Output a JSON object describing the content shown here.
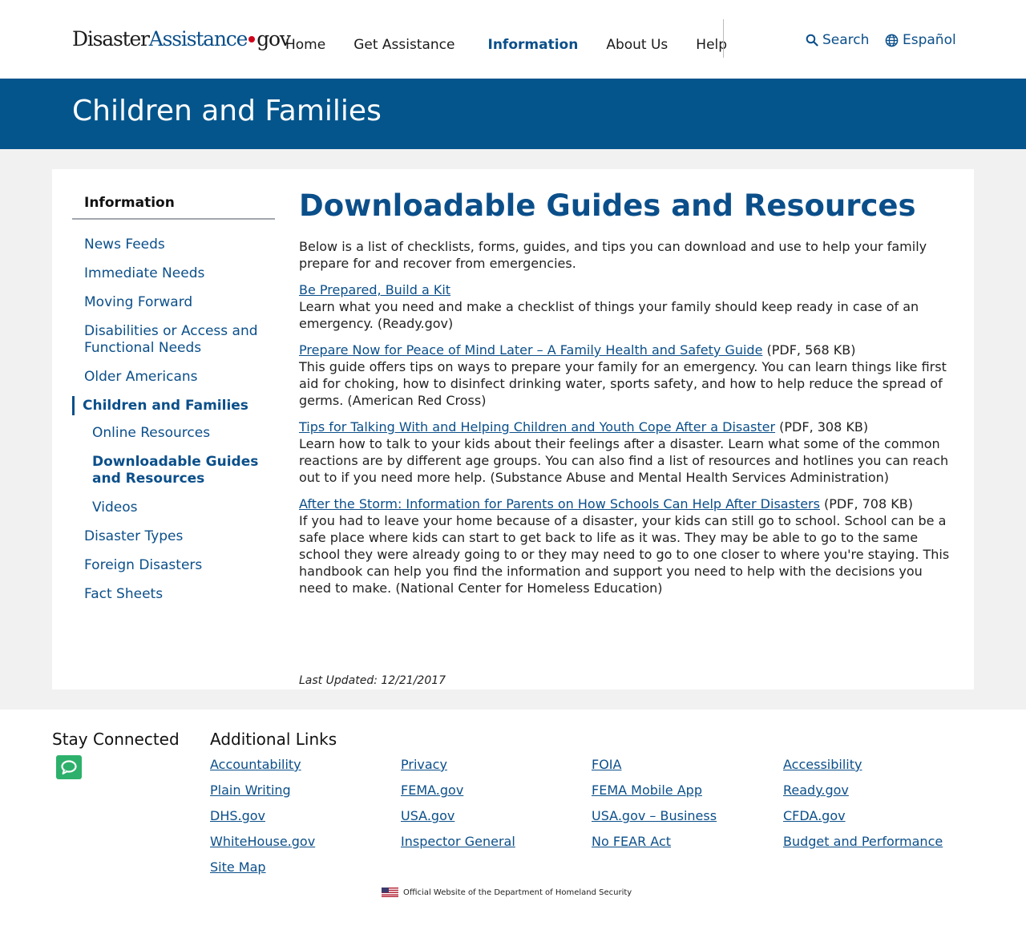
{
  "logo": {
    "part1": "Disaster",
    "part2": "Assistance",
    "part3": "gov"
  },
  "nav": {
    "home": "Home",
    "get_assistance": "Get Assistance",
    "information": "Information",
    "about_us": "About Us",
    "help": "Help"
  },
  "utility": {
    "search": "Search",
    "language": "Español"
  },
  "hero": {
    "title": "Children and Families"
  },
  "sidebar": {
    "title": "Information",
    "items": [
      "News Feeds",
      "Immediate Needs",
      "Moving Forward",
      "Disabilities or Access and Functional Needs",
      "Older Americans",
      "Children and Families",
      "Online Resources",
      "Downloadable Guides and Resources",
      "Videos",
      "Disaster Types",
      "Foreign Disasters",
      "Fact Sheets"
    ]
  },
  "main": {
    "title": "Downloadable Guides and Resources",
    "intro": "Below is a list of checklists, forms, guides, and tips you can download and use to help your family prepare for and recover from emergencies.",
    "resources": [
      {
        "link": "Be Prepared, Build a Kit",
        "meta": "",
        "desc": "Learn what you need and make a checklist of things your family should keep ready in case of an emergency. (Ready.gov)"
      },
      {
        "link": "Prepare Now for Peace of Mind Later – A Family Health and Safety Guide",
        "meta": " (PDF, 568 KB)",
        "desc": "This guide offers tips on ways to prepare your family for an emergency. You can learn things like first aid for choking, how to disinfect drinking water, sports safety, and how to help reduce the spread of germs. (American Red Cross)"
      },
      {
        "link": "Tips for Talking With and Helping Children and Youth Cope After a Disaster",
        "meta": " (PDF, 308 KB)",
        "desc": "Learn how to talk to your kids about their feelings after a disaster. Learn what some of the common reactions are by different age groups. You can also find a list of resources and hotlines you can reach out to if you need more help. (Substance Abuse and Mental Health Services Administration)"
      },
      {
        "link": "After the Storm: Information for Parents on How Schools Can Help After Disasters",
        "meta": " (PDF, 708 KB)",
        "desc": "If you had to leave your home because of a disaster, your kids can still go to school. School can be a safe place where kids can start to get back to life as it was. They may be able to go to the same school they were already going to or they may need to go to one closer to where you're staying. This handbook can help you find the information and support you need to help with the decisions you need to make. (National Center for Homeless Education)"
      }
    ],
    "last_updated": "Last Updated: 12/21/2017"
  },
  "footer": {
    "stay_connected": "Stay Connected",
    "additional_links": "Additional Links",
    "links": [
      "Accountability",
      "Privacy",
      "FOIA",
      "Accessibility",
      "Plain Writing",
      "FEMA.gov",
      "FEMA Mobile App",
      "Ready.gov",
      "DHS.gov",
      "USA.gov",
      "USA.gov – Business",
      "CFDA.gov",
      "WhiteHouse.gov",
      "Inspector General",
      "No FEAR Act",
      "Budget and Performance",
      "Site Map"
    ],
    "official": "Official Website of the Department of Homeland Security"
  },
  "colors": {
    "brand_blue": "#03558c",
    "link_blue": "#0b4f8a",
    "chat_green": "#2db06b",
    "logo_dot": "#d0021b"
  },
  "icons": {
    "search": "search-icon",
    "language": "globe-icon",
    "chat": "chat-bubble-icon",
    "flag": "us-flag-icon"
  }
}
